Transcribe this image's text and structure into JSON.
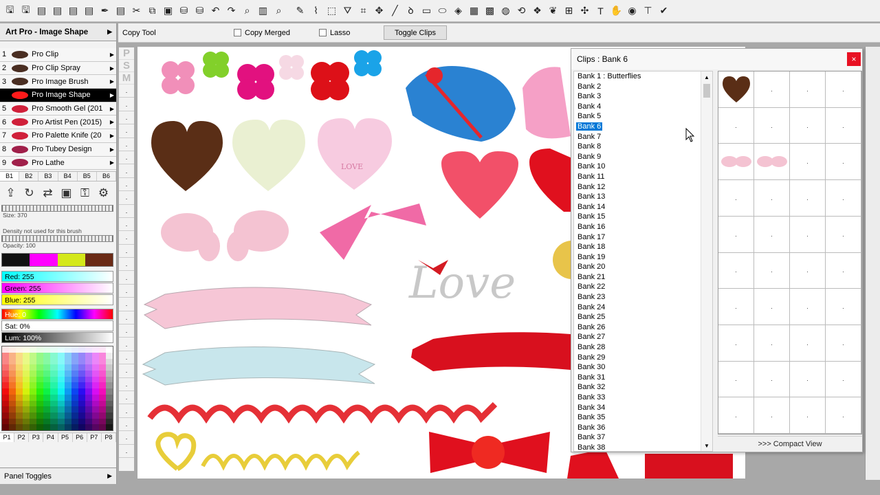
{
  "toolbar": {
    "icons": [
      "save-icon",
      "save-icon",
      "page-icon",
      "page-icon",
      "page-icon",
      "page-icon",
      "pen-icon",
      "page-icon",
      "scissors-icon",
      "copy-icon",
      "paste-icon",
      "stamp-icon",
      "stamp-icon",
      "undo-icon",
      "redo-icon",
      "zoom-icon",
      "levels-icon",
      "zoom-icon",
      "pencil-icon",
      "dropper-icon",
      "select-icon",
      "bucket-icon",
      "crop-icon",
      "move-icon",
      "line-icon",
      "lasso-icon",
      "rect-icon",
      "ellipse-icon",
      "fill-icon",
      "gradient-icon",
      "pattern-icon",
      "blend-icon",
      "rotate-icon",
      "clone-icon",
      "swirl-icon",
      "grid-icon",
      "fx-icon",
      "text-icon",
      "hand-icon",
      "color-icon",
      "pipe-icon",
      "wand-icon"
    ]
  },
  "panel": {
    "title": "Art Pro - Image Shape",
    "brushes": [
      {
        "num": "1",
        "label": "Pro Clip",
        "color": "#4a2e22"
      },
      {
        "num": "2",
        "label": "Pro Clip Spray",
        "color": "#4a2e22"
      },
      {
        "num": "3",
        "label": "Pro Image Brush",
        "color": "#4a2e22"
      },
      {
        "num": "4",
        "label": "Pro Image Shape",
        "color": "#ff1a1a"
      },
      {
        "num": "5",
        "label": "Pro Smooth Gel (201",
        "color": "#d0203a"
      },
      {
        "num": "6",
        "label": "Pro Artist Pen (2015)",
        "color": "#d0203a"
      },
      {
        "num": "7",
        "label": "Pro Palette Knife (20",
        "color": "#d0203a"
      },
      {
        "num": "8",
        "label": "Pro Tubey Design",
        "color": "#a0204a"
      },
      {
        "num": "9",
        "label": "Pro Lathe",
        "color": "#a0204a"
      }
    ],
    "banks": [
      "B1",
      "B2",
      "B3",
      "B4",
      "B5",
      "B6"
    ],
    "size_label": "Size: 370",
    "density_label": "Density not used for this brush",
    "opacity_label": "Opacity: 100",
    "red_label": "Red: 255",
    "green_label": "Green: 255",
    "blue_label": "Blue: 255",
    "hue_label": "Hue: 0",
    "sat_label": "Sat: 0%",
    "lum_label": "Lum: 100%",
    "pages": [
      "P1",
      "P2",
      "P3",
      "P4",
      "P5",
      "P6",
      "P7",
      "P8"
    ],
    "panel_toggles": "Panel Toggles",
    "psm": [
      "P",
      "S",
      "M"
    ]
  },
  "options": {
    "tool": "Copy Tool",
    "copy_merged": "Copy Merged",
    "lasso": "Lasso",
    "toggle_clips": "Toggle Clips"
  },
  "canvas": {
    "love_small": "LOVE",
    "love_script": "Love"
  },
  "clips": {
    "title": "Clips : Bank 6",
    "close": "×",
    "banks": [
      "Bank 1 : Butterflies",
      "Bank 2",
      "Bank 3",
      "Bank 4",
      "Bank 5",
      "Bank 6",
      "Bank 7",
      "Bank 8",
      "Bank 9",
      "Bank 10",
      "Bank 11",
      "Bank 12",
      "Bank 13",
      "Bank 14",
      "Bank 15",
      "Bank 16",
      "Bank 17",
      "Bank 18",
      "Bank 19",
      "Bank 20",
      "Bank 21",
      "Bank 22",
      "Bank 23",
      "Bank 24",
      "Bank 25",
      "Bank 26",
      "Bank 27",
      "Bank 28",
      "Bank 29",
      "Bank 30",
      "Bank 31",
      "Bank 32",
      "Bank 33",
      "Bank 34",
      "Bank 35",
      "Bank 36",
      "Bank 37",
      "Bank 38"
    ],
    "selected_bank": "Bank 6",
    "grid_dot": ".",
    "compact_view": ">>> Compact View"
  },
  "colors": {
    "selection": "#0078d7",
    "close_red": "#e81123",
    "swatches": [
      "#111111",
      "#ff00ff",
      "#d4e81a",
      "#6a2a16"
    ]
  }
}
